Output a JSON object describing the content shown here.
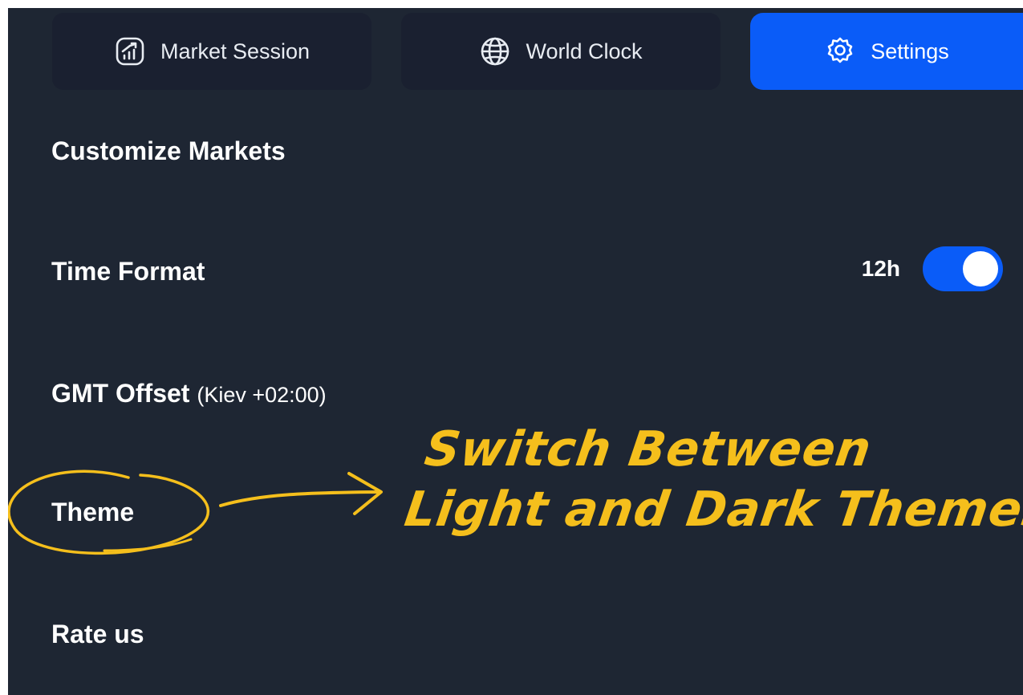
{
  "tabs": [
    {
      "label": "Market Session",
      "icon": "chart-icon",
      "active": false
    },
    {
      "label": "World Clock",
      "icon": "globe-icon",
      "active": false
    },
    {
      "label": "Settings",
      "icon": "gear-icon",
      "active": true
    }
  ],
  "settings": {
    "customize_markets": "Customize Markets",
    "time_format": "Time Format",
    "time_format_value": "12h",
    "time_format_on": true,
    "gmt_offset": "GMT Offset",
    "gmt_offset_value": "(Kiev +02:00)",
    "theme": "Theme",
    "rate_us": "Rate us"
  },
  "annotation": {
    "line1": "Switch Between",
    "line2": "Light and Dark Themes"
  },
  "colors": {
    "panel_bg": "#1e2633",
    "tab_bg": "#1a2030",
    "accent": "#0a5cf8",
    "annotation": "#f5bf1c"
  }
}
